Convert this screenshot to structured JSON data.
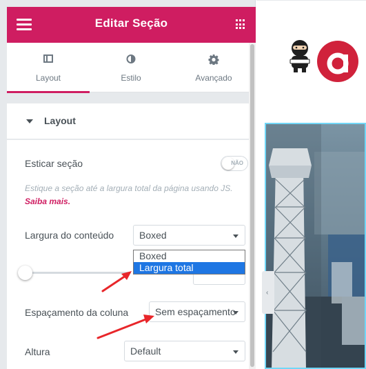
{
  "header": {
    "title": "Editar Seção",
    "menu_icon": "hamburger-menu-icon",
    "grid_icon": "apps-grid-icon"
  },
  "tabs": [
    {
      "label": "Layout",
      "icon": "layout-columns-icon",
      "active": true
    },
    {
      "label": "Estilo",
      "icon": "contrast-half-circle-icon",
      "active": false
    },
    {
      "label": "Avançado",
      "icon": "gear-icon",
      "active": false
    }
  ],
  "section": {
    "title": "Layout",
    "caret_icon": "caret-down-icon"
  },
  "controls": {
    "stretch": {
      "label": "Esticar seção",
      "toggle_text": "NÃO",
      "description": "Estique a seção até a largura total da página usando JS.",
      "link_text": "Saiba mais."
    },
    "content_width": {
      "label": "Largura do conteúdo",
      "value": "Boxed",
      "options": [
        "Boxed",
        "Largura total"
      ],
      "highlighted": "Largura total"
    },
    "column_gap": {
      "label": "Espaçamento da coluna",
      "value": "Sem espaçamento"
    },
    "height": {
      "label": "Altura",
      "value": "Default"
    }
  },
  "colors": {
    "brand": "#cf1d61",
    "panel_bg": "#e6e9ec",
    "highlight": "#1e76e3",
    "annotation_arrow": "#e8262a"
  },
  "preview": {
    "collapse_icon": "chevron-left-icon"
  }
}
